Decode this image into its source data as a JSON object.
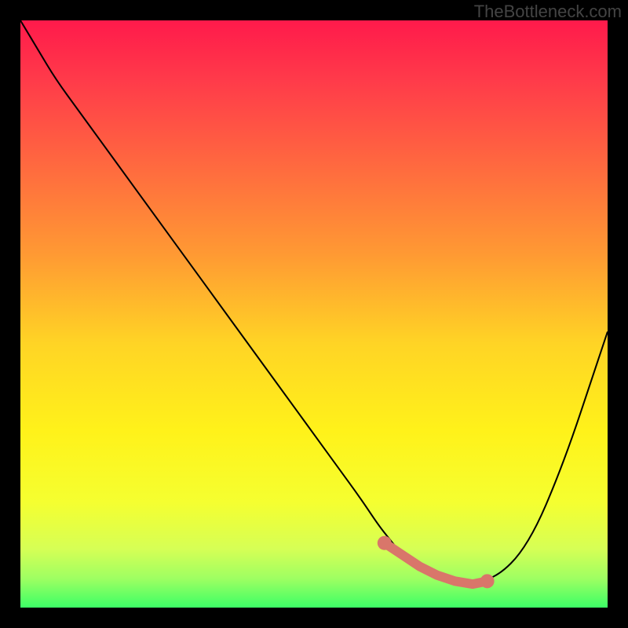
{
  "watermark": "TheBottleneck.com",
  "chart_data": {
    "type": "line",
    "title": "",
    "xlabel": "",
    "ylabel": "",
    "xlim": [
      0,
      100
    ],
    "ylim": [
      0,
      100
    ],
    "series": [
      {
        "name": "bottleneck-curve",
        "x": [
          0,
          3,
          6,
          10,
          14,
          18,
          22,
          26,
          30,
          34,
          38,
          42,
          46,
          50,
          54,
          58,
          61,
          63,
          65,
          67.5,
          70,
          72.5,
          75,
          77,
          79,
          82,
          85,
          88,
          91,
          94,
          97,
          100
        ],
        "values": [
          100,
          95,
          90,
          84.5,
          79,
          73.5,
          68,
          62.5,
          57,
          51.5,
          46,
          40.5,
          35,
          29.5,
          24,
          18.5,
          14,
          11.5,
          9,
          7,
          5.5,
          4.5,
          4,
          4,
          4.5,
          6,
          9,
          14,
          21,
          29,
          38,
          47
        ],
        "note": "V-shaped curve; minimum (~0 bottleneck) near x≈75; left side descends from ~100 at x=0; right side rises to ~47 at x=100"
      }
    ],
    "highlight_segment": {
      "description": "thick salmon segment with endpoint dots along the trough of the V",
      "color": "#d9766a",
      "points_x": [
        62,
        65,
        68,
        71,
        74,
        77,
        79.5
      ],
      "points_values": [
        11,
        9,
        7,
        5.5,
        4.5,
        4,
        4.5
      ],
      "end_dots": [
        {
          "x": 62,
          "v": 11
        },
        {
          "x": 79.5,
          "v": 4.5
        }
      ]
    },
    "background_gradient": {
      "type": "vertical",
      "stops": [
        {
          "offset": 0.0,
          "color": "#ff1a4b"
        },
        {
          "offset": 0.1,
          "color": "#ff3a4a"
        },
        {
          "offset": 0.25,
          "color": "#ff6a3f"
        },
        {
          "offset": 0.4,
          "color": "#ff9a33"
        },
        {
          "offset": 0.55,
          "color": "#ffd425"
        },
        {
          "offset": 0.7,
          "color": "#fff21a"
        },
        {
          "offset": 0.82,
          "color": "#f5ff30"
        },
        {
          "offset": 0.9,
          "color": "#d6ff55"
        },
        {
          "offset": 0.95,
          "color": "#9fff62"
        },
        {
          "offset": 1.0,
          "color": "#3cff66"
        }
      ]
    }
  }
}
